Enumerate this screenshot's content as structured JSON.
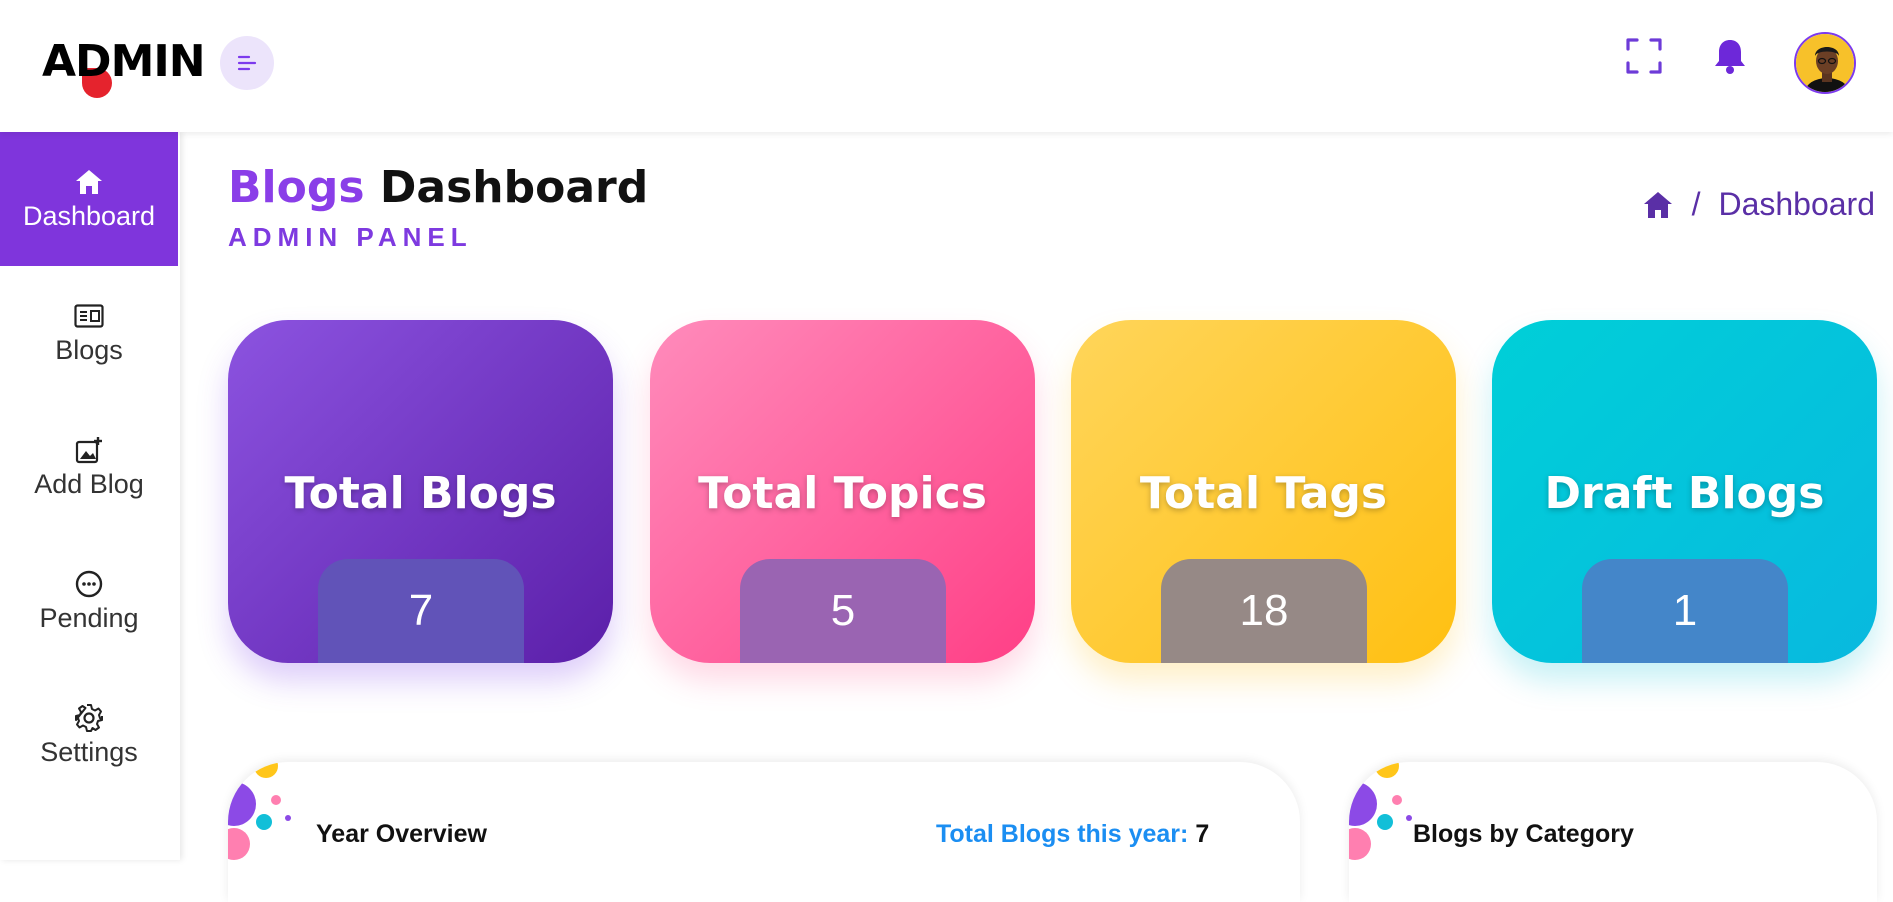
{
  "header": {
    "logo_text": "ADMIN"
  },
  "sidebar": {
    "items": [
      {
        "label": "Dashboard",
        "icon": "home-icon",
        "active": true
      },
      {
        "label": "Blogs",
        "icon": "newspaper-icon",
        "active": false
      },
      {
        "label": "Add Blog",
        "icon": "add-image-icon",
        "active": false
      },
      {
        "label": "Pending",
        "icon": "dots-circle-icon",
        "active": false
      },
      {
        "label": "Settings",
        "icon": "gear-icon",
        "active": false
      }
    ]
  },
  "page": {
    "title_accent": "Blogs",
    "title_main": "Dashboard",
    "subtitle": "ADMIN PANEL"
  },
  "breadcrumb": {
    "separator": "/",
    "current": "Dashboard"
  },
  "cards": [
    {
      "title": "Total Blogs",
      "value": "7"
    },
    {
      "title": "Total Topics",
      "value": "5"
    },
    {
      "title": "Total Tags",
      "value": "18"
    },
    {
      "title": "Draft Blogs",
      "value": "1"
    }
  ],
  "panels": {
    "year_overview": {
      "title": "Year Overview",
      "stat_label": "Total Blogs this year:",
      "stat_value": "7"
    },
    "by_category": {
      "title": "Blogs by Category"
    }
  },
  "colors": {
    "primary": "#7f35dc",
    "pink": "#ff3f86",
    "yellow": "#ffc012",
    "cyan": "#00cfd8",
    "link_blue": "#1b8ef2"
  }
}
